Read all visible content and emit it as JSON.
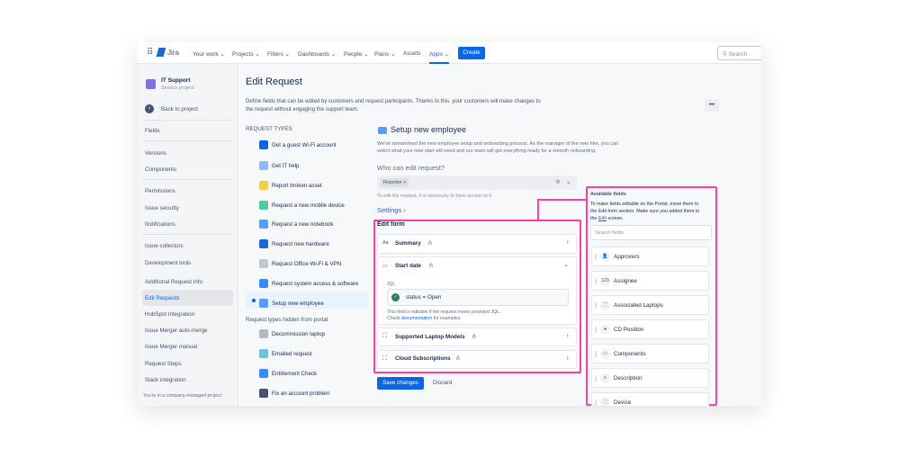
{
  "nav": {
    "logo": "Jira",
    "items": [
      "Your work",
      "Projects",
      "Filters",
      "Dashboards",
      "People",
      "Plans",
      "Assets",
      "Apps"
    ],
    "create": "Create",
    "search_placeholder": "Search"
  },
  "project": {
    "name": "IT Support",
    "type": "Service project",
    "back": "Back to project"
  },
  "sidebar": {
    "items": [
      "Fields",
      "Versions",
      "Components",
      "Permissions",
      "Issue security",
      "Notifications",
      "Issue collectors",
      "Development tools",
      "Additional Request Info",
      "Edit Requests",
      "HubSpot Integration",
      "Issue Merger auto-merge",
      "Issue Merger manual",
      "Request Steps",
      "Slack integration"
    ],
    "footer": "You're in a company-managed project"
  },
  "page": {
    "title": "Edit Request",
    "description_1": "Define fields that can be edited by customers and request participants. Thanks to this, your customers will make changes to",
    "description_2": "the request without engaging the support team.",
    "more": "•••"
  },
  "request_types": {
    "heading": "REQUEST TYPES",
    "items": [
      "Get a guest Wi-Fi account",
      "Get IT help",
      "Report broken asset",
      "Request a new mobile device",
      "Request a new notebook",
      "Request new hardware",
      "Request Office Wi-Fi & VPN",
      "Request system access & software",
      "Setup new employee"
    ],
    "hidden_heading": "Request types hidden from portal",
    "hidden_items": [
      "Decommission laptop",
      "Emailed request",
      "Entitlement Check",
      "Fix an account problem"
    ]
  },
  "detail": {
    "title": "Setup new employee",
    "desc_1": "We've streamlined the new employee setup and onboarding process. As the manager of the new hire, you can",
    "desc_2": "select what your new start will need and our team will get everything ready for a smooth onboarding.",
    "who_label": "Who can edit request?",
    "who_value": "Reporter",
    "who_help": "To edit the request, it is necessary to have access to it.",
    "settings": "Settings"
  },
  "edit_form": {
    "title": "Edit form",
    "fields": [
      "Summary",
      "Start date",
      "Supported Laptop Models",
      "Cloud Subscriptions"
    ],
    "jql_label": "JQL",
    "jql_value": "status = Open",
    "help_1": "This field is editable if the request meets provided JQL.",
    "help_2_pre": "Check",
    "help_2_link": "documentation",
    "help_2_post": "for examples."
  },
  "actions": {
    "save": "Save changes",
    "discard": "Discard"
  },
  "available": {
    "title": "Available fields",
    "desc_1": "To make fields editable on the Portal, move them to",
    "desc_2": "the Edit form section. Make sure you added them to",
    "desc_3_pre": "the",
    "desc_3_link": "Edit",
    "desc_3_post": "screen.",
    "search_placeholder": "Search fields",
    "fields": [
      "Approvers",
      "Assignee",
      "Associated Laptops",
      "CD Position",
      "Components",
      "Description",
      "Device"
    ]
  },
  "colors": {
    "accent": "#0c66e4",
    "highlight": "#ff3fa4",
    "success": "#1f845a"
  }
}
